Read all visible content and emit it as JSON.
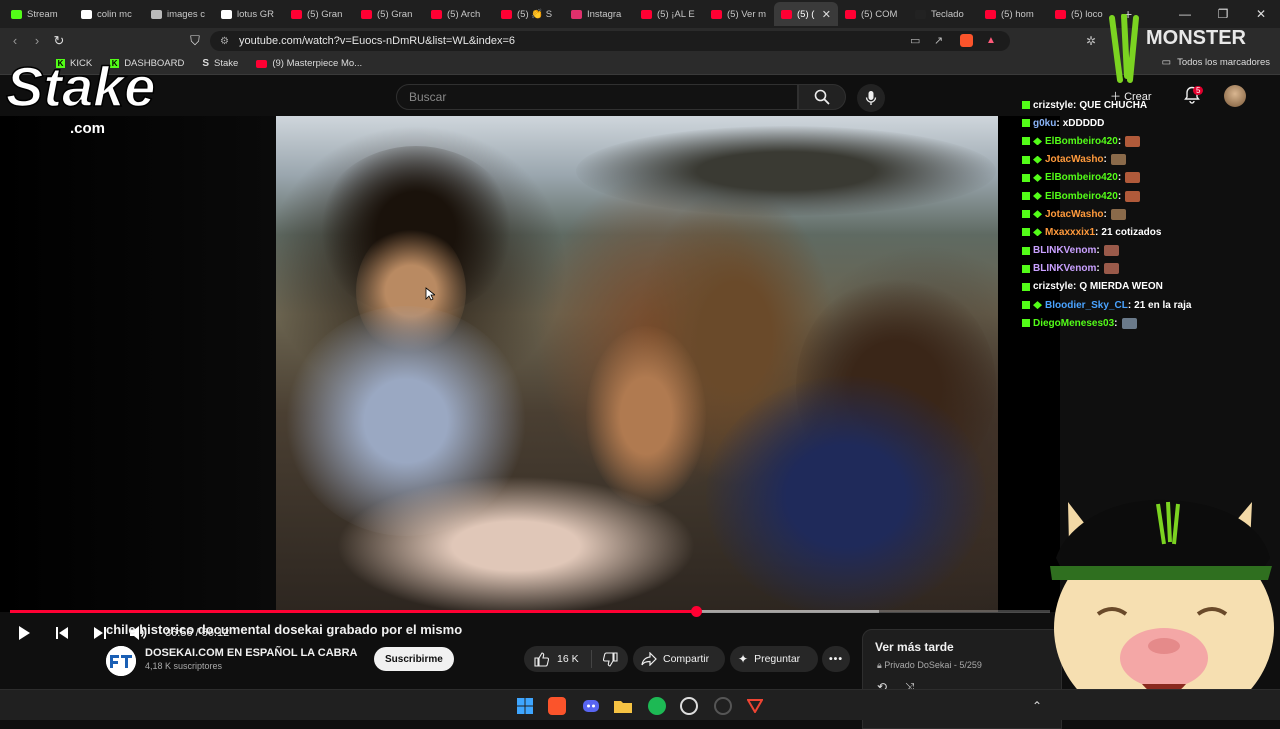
{
  "tabs": [
    {
      "label": "Stream",
      "color": "#53fc18"
    },
    {
      "label": "colin mc",
      "color": "#ffffff"
    },
    {
      "label": "images c",
      "color": "#bbbbbb"
    },
    {
      "label": "lotus GR",
      "color": "#ffffff"
    },
    {
      "label": "(5) Gran",
      "color": "#ff0033"
    },
    {
      "label": "(5) Gran",
      "color": "#ff0033"
    },
    {
      "label": "(5) Arch",
      "color": "#ff0033"
    },
    {
      "label": "(5) 👏 S",
      "color": "#ff0033"
    },
    {
      "label": "Instagra",
      "color": "#e1306c"
    },
    {
      "label": "(5) ¡AL E",
      "color": "#ff0033"
    },
    {
      "label": "(5) Ver m",
      "color": "#ff0033"
    },
    {
      "label": "(5) (",
      "color": "#ff0033",
      "active": true
    },
    {
      "label": "(5) COM",
      "color": "#ff0033"
    },
    {
      "label": "Teclado",
      "color": "#222222"
    },
    {
      "label": "(5) hom",
      "color": "#ff0033"
    },
    {
      "label": "(5) loco",
      "color": "#ff0033"
    }
  ],
  "browser": {
    "url": "youtube.com/watch?v=Euocs-nDmRU&list=WL&index=6",
    "bookmarks": [
      {
        "label": "KICK",
        "icon": "kick-icon"
      },
      {
        "label": "DASHBOARD",
        "icon": "kick-icon"
      },
      {
        "label": "Stake",
        "icon": "stake-icon"
      },
      {
        "label": "(9) Masterpiece Mo...",
        "icon": "youtube-icon"
      }
    ],
    "all_bookmarks": "Todos los marcadores"
  },
  "youtube": {
    "search_placeholder": "Buscar",
    "create_label": "Crear",
    "notif_count": "5",
    "time": "36:56 / 56:12",
    "progress": 0.6592,
    "buffered": 0.8351,
    "title": "chile historico documental dosekai grabado por el mismo",
    "channel": "DOSEKAI.COM EN ESPAÑOL LA CABRA",
    "subscribers": "4,18 K suscriptores",
    "subscribe": "Suscribirme",
    "likes": "16 K",
    "share": "Compartir",
    "ask": "Preguntar",
    "queue_title": "Ver más tarde",
    "queue_sub": "Privado DoSekai - 5/259"
  },
  "overlay": {
    "stake_text": "Stake",
    "stake_com": ".com",
    "monster_text": "MONSTER"
  },
  "chat": [
    {
      "user": "crizstyle",
      "color": "#ffffff",
      "badge": "kick",
      "text": "QUE CHUCHA"
    },
    {
      "user": "g0ku",
      "color": "#8ab4f8",
      "badge": "kick",
      "text": "xDDDDD"
    },
    {
      "user": "ElBombeiro420",
      "color": "#53fc18",
      "badge": "both",
      "emote": "#b05a3a"
    },
    {
      "user": "JotacWasho",
      "color": "#ff9a3c",
      "badge": "both",
      "emote": "#8a6a4a"
    },
    {
      "user": "ElBombeiro420",
      "color": "#53fc18",
      "badge": "both",
      "emote": "#b05a3a"
    },
    {
      "user": "ElBombeiro420",
      "color": "#53fc18",
      "badge": "both",
      "emote": "#b05a3a"
    },
    {
      "user": "JotacWasho",
      "color": "#ff9a3c",
      "badge": "both",
      "emote": "#8a6a4a"
    },
    {
      "user": "Mxaxxxix1",
      "color": "#ff9a3c",
      "badge": "both",
      "text": "21 cotizados"
    },
    {
      "user": "BLINKVenom",
      "color": "#c9a0ff",
      "badge": "kick",
      "emote": "#9a5a4a"
    },
    {
      "user": "BLINKVenom",
      "color": "#c9a0ff",
      "badge": "kick",
      "emote": "#9a5a4a"
    },
    {
      "user": "crizstyle",
      "color": "#ffffff",
      "badge": "kick",
      "text": "Q MIERDA WEON"
    },
    {
      "user": "Bloodier_Sky_CL",
      "color": "#4aa3ff",
      "badge": "both",
      "text": "21 en la raja"
    },
    {
      "user": "DiegoMeneses03",
      "color": "#53fc18",
      "badge": "kick",
      "emote": "#6a7a8a"
    }
  ],
  "colors": {
    "accent": "#ff0033",
    "kick": "#53fc18",
    "bg": "#0f0f0f"
  }
}
